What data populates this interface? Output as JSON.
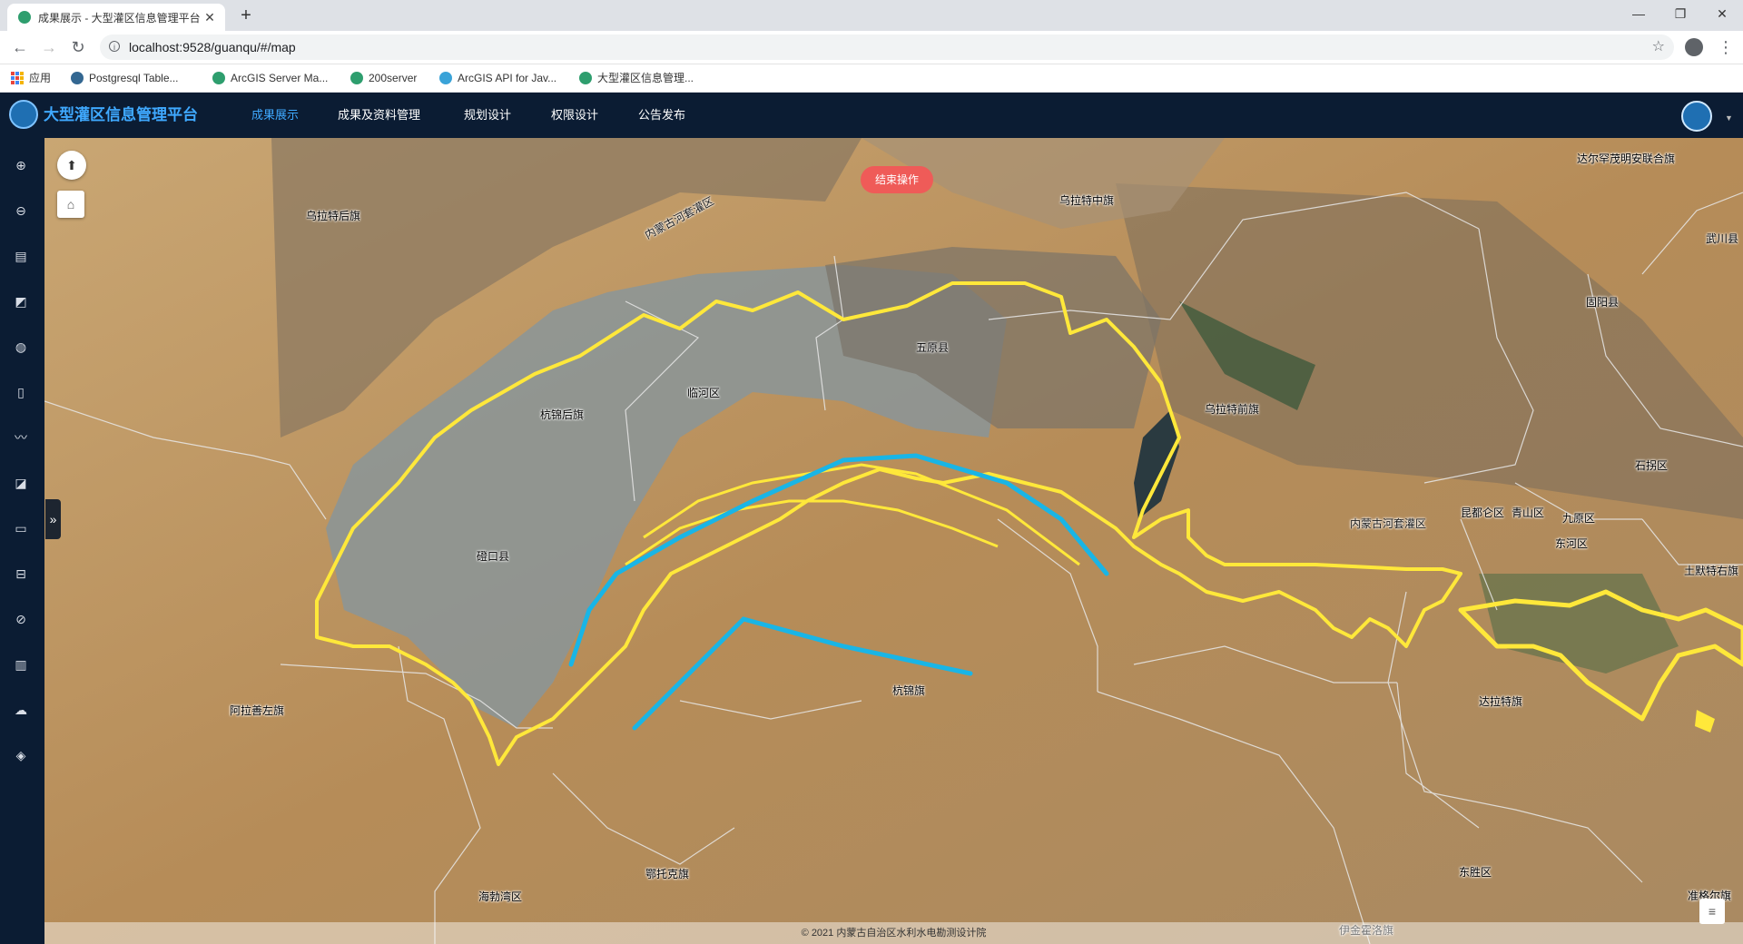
{
  "browser": {
    "tab_title": "成果展示 - 大型灌区信息管理平台",
    "tab_close": "✕",
    "new_tab": "+",
    "url": "localhost:9528/guanqu/#/map",
    "bookmarks": [
      "应用",
      "Postgresql Table...",
      "ArcGIS Server Ma...",
      "200server",
      "ArcGIS API for Jav...",
      "大型灌区信息管理..."
    ]
  },
  "app": {
    "title": "大型灌区信息管理平台",
    "nav": [
      "成果展示",
      "成果及资料管理",
      "规划设计",
      "权限设计",
      "公告发布"
    ],
    "active_nav": 0,
    "accent_color": "#3fa9ff",
    "header_color": "#0b1c33"
  },
  "toolbar": {
    "tools": [
      "zoom-in-icon",
      "zoom-out-icon",
      "layers-icon",
      "measure-icon",
      "globe-icon",
      "marker-icon",
      "line-icon",
      "draw-icon",
      "ruler-icon",
      "vehicle-icon",
      "compass-icon",
      "chart-icon",
      "upload-icon",
      "layer-stack-icon"
    ]
  },
  "map": {
    "end_operation_label": "结束操作",
    "copyright": "© 2021 内蒙古自治区水利水电勘测设计院",
    "labels": [
      "乌拉特后旗",
      "乌拉特中旗",
      "达尔罕茂明安联合旗",
      "武川县",
      "固阳县",
      "五原县",
      "临河区",
      "杭锦后旗",
      "乌拉特前旗",
      "磴口县",
      "石拐区",
      "昆都仑区",
      "青山区",
      "九原区",
      "东河区",
      "土默特右旗",
      "达拉特旗",
      "杭锦旗",
      "阿拉善左旗",
      "鄂托克旗",
      "海勃湾区",
      "东胜区",
      "伊金霍洛旗",
      "准格尔旗",
      "内蒙古河套灌区"
    ],
    "boundary_color": "#ffe83a",
    "line_color": "#19b5e6"
  }
}
